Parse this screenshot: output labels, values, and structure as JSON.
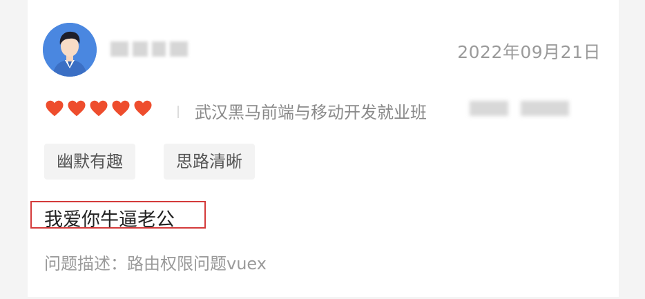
{
  "review": {
    "date": "2022年09月21日",
    "rating": 5,
    "course": "武汉黑马前端与移动开发就业班",
    "tags": [
      "幽默有趣",
      "思路清晰"
    ],
    "comment": "我爱你牛逼老公",
    "question": "问题描述：路由权限问题vuex"
  },
  "colors": {
    "heart": "#ee4d2d",
    "highlight_border": "#d43a3a",
    "avatar_bg": "#4a87e0"
  }
}
